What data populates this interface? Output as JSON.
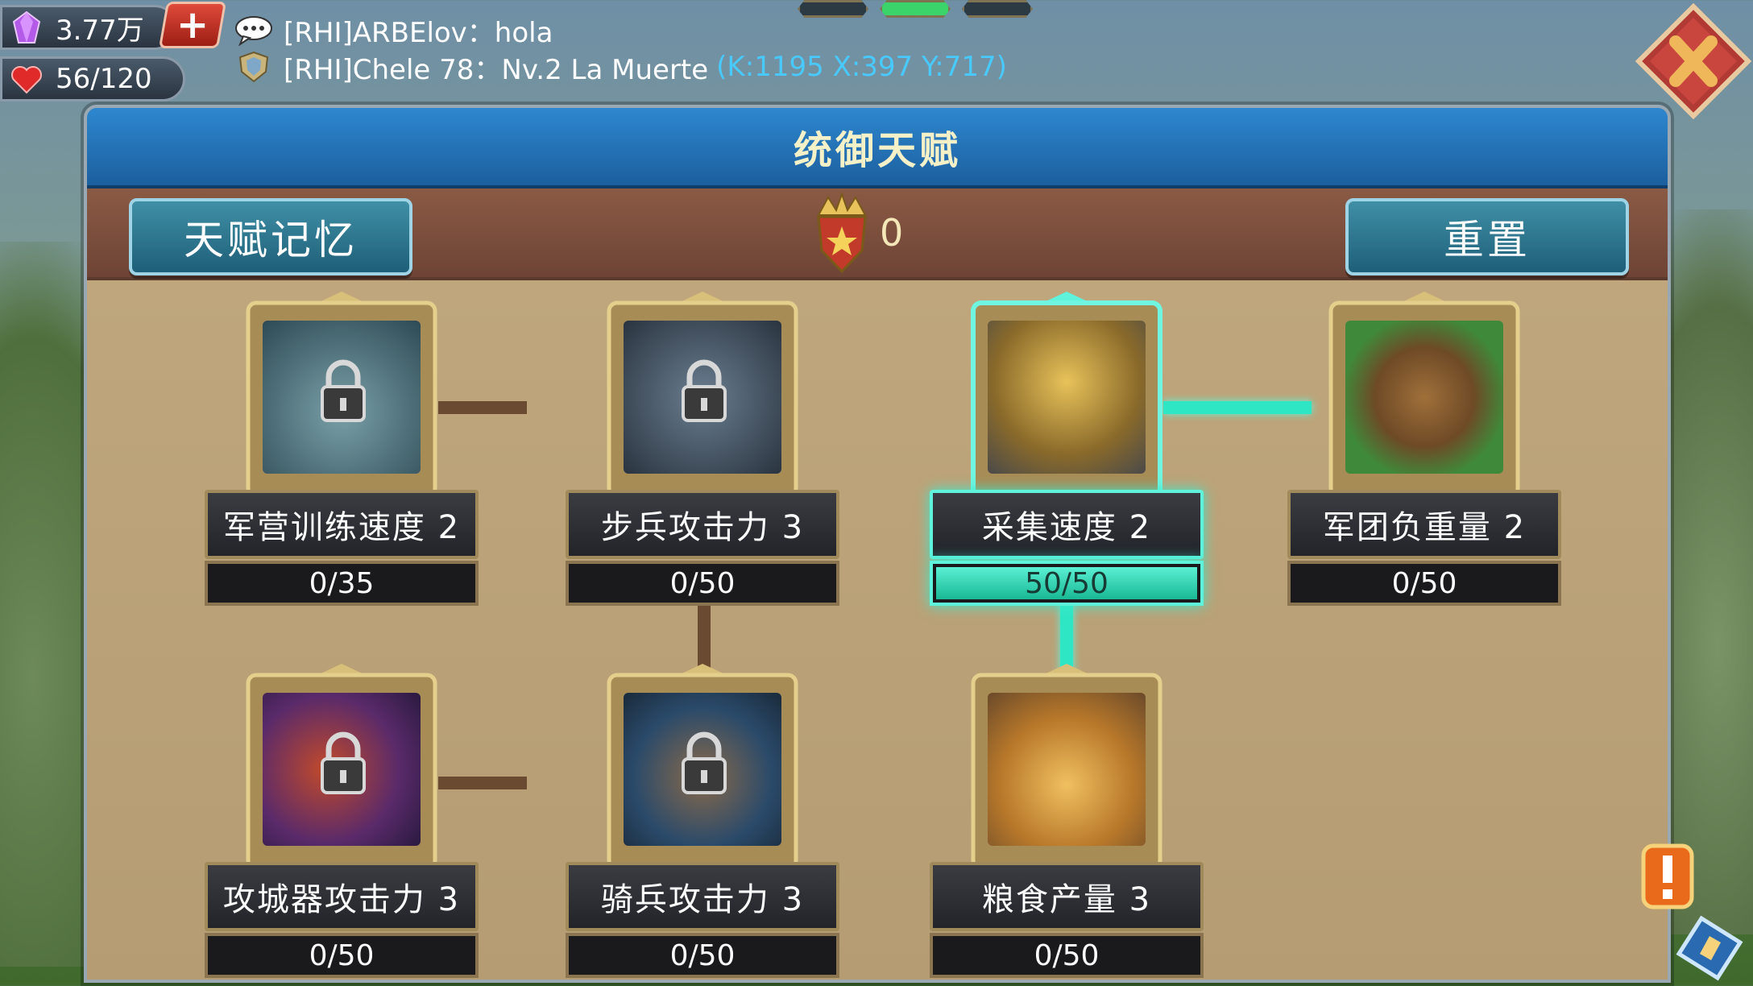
{
  "hud": {
    "gems": "3.77万",
    "stamina": "56/120",
    "plus_label": "+"
  },
  "chat": [
    {
      "text": "[RHI]ARBElov：hola",
      "coords": ""
    },
    {
      "text": "[RHI]Chele 78：Nv.2 La Muerte",
      "coords": "(K:1195 X:397 Y:717)"
    }
  ],
  "page_indicator": {
    "count": 3,
    "active_index": 1
  },
  "panel": {
    "title": "统御天赋",
    "memory_button": "天赋记忆",
    "reset_button": "重置",
    "points": "0"
  },
  "talents": [
    {
      "name": "军营训练速度 2",
      "progress_text": "0/35",
      "progress": 0,
      "locked": true,
      "portrait": "training-dummy"
    },
    {
      "name": "步兵攻击力 3",
      "progress_text": "0/50",
      "progress": 0,
      "locked": true,
      "portrait": "infantry-soldier"
    },
    {
      "name": "采集速度 2",
      "progress_text": "50/50",
      "progress": 1,
      "locked": false,
      "portrait": "gathering-tools"
    },
    {
      "name": "军团负重量 2",
      "progress_text": "0/50",
      "progress": 0,
      "locked": false,
      "portrait": "backpack"
    },
    {
      "name": "攻城器攻击力 3",
      "progress_text": "0/50",
      "progress": 0,
      "locked": true,
      "portrait": "siege-sword"
    },
    {
      "name": "骑兵攻击力 3",
      "progress_text": "0/50",
      "progress": 0,
      "locked": true,
      "portrait": "cavalry-rider"
    },
    {
      "name": "粮食产量 3",
      "progress_text": "0/50",
      "progress": 0,
      "locked": false,
      "portrait": "wheat-field"
    }
  ],
  "colors": {
    "title_bar": "#2e87cf",
    "active_glow": "#2fe6c4",
    "coords_text": "#48c9ff"
  }
}
